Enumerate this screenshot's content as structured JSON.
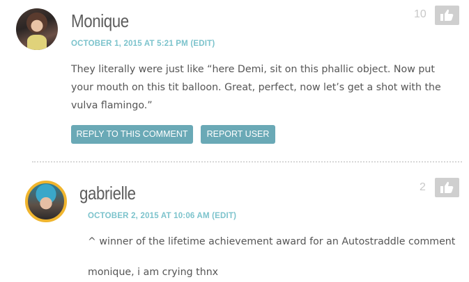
{
  "comments": [
    {
      "author": "Monique",
      "meta": "OCTOBER 1, 2015 AT 5:21 PM (EDIT)",
      "text": "They literally were just like “here Demi, sit on this phallic object. Now put your mouth on this tit balloon. Great, perfect, now let’s get a shot with the vulva flamingo.”",
      "votes": "10",
      "reply_label": "REPLY TO THIS COMMENT",
      "report_label": "REPORT USER"
    },
    {
      "author": "gabrielle",
      "meta": "OCTOBER 2, 2015 AT 10:06 AM (EDIT)",
      "text1": "^ winner of the lifetime achievement award for an Autostraddle comment",
      "text2": "monique, i am crying thnx",
      "votes": "2"
    }
  ],
  "colors": {
    "accent": "#6aa9b6",
    "meta": "#7cc3cc",
    "like_bg": "#cfcfcf",
    "avatar_ring": "#f0b52e"
  },
  "icons": {
    "like": "thumbs-up-icon"
  }
}
